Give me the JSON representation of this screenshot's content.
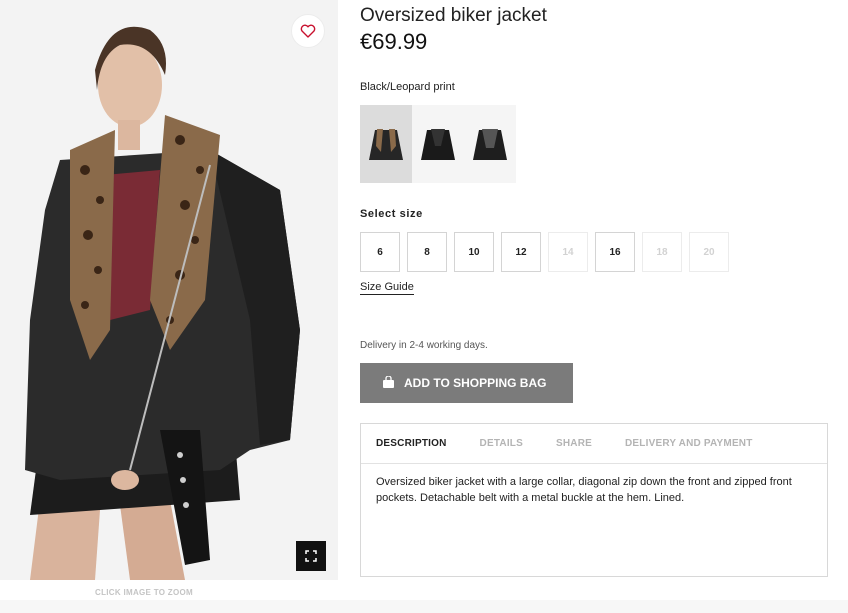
{
  "product": {
    "title": "Oversized biker jacket",
    "price": "€69.99",
    "color_name": "Black/Leopard print",
    "swatches": [
      "Black/Leopard print",
      "Black",
      "Black"
    ],
    "size_label": "Select size",
    "sizes": [
      {
        "label": "6",
        "available": true
      },
      {
        "label": "8",
        "available": true
      },
      {
        "label": "10",
        "available": true
      },
      {
        "label": "12",
        "available": true
      },
      {
        "label": "14",
        "available": false
      },
      {
        "label": "16",
        "available": true
      },
      {
        "label": "18",
        "available": false
      },
      {
        "label": "20",
        "available": false
      }
    ],
    "size_guide": "Size Guide",
    "delivery": "Delivery in 2-4 working days.",
    "add_to_bag": "ADD TO SHOPPING BAG"
  },
  "image": {
    "zoom_hint": "CLICK IMAGE TO ZOOM",
    "favorite_icon": "heart-icon",
    "zoom_icon": "expand-icon"
  },
  "tabs": [
    {
      "label": "DESCRIPTION",
      "active": true
    },
    {
      "label": "DETAILS",
      "active": false
    },
    {
      "label": "SHARE",
      "active": false
    },
    {
      "label": "DELIVERY AND PAYMENT",
      "active": false
    }
  ],
  "description": "Oversized biker jacket with a large collar, diagonal zip down the front and zipped front pockets. Detachable belt with a metal buckle at the hem. Lined.",
  "colors": {
    "button_bg": "#7b7b7b",
    "heart": "#c8102e",
    "active_swatch": "#dcdcdc"
  }
}
